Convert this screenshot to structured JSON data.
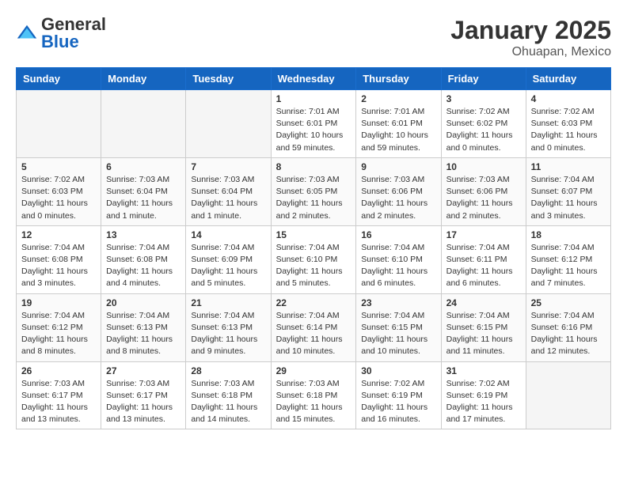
{
  "header": {
    "logo_general": "General",
    "logo_blue": "Blue",
    "month_year": "January 2025",
    "location": "Ohuapan, Mexico"
  },
  "days_of_week": [
    "Sunday",
    "Monday",
    "Tuesday",
    "Wednesday",
    "Thursday",
    "Friday",
    "Saturday"
  ],
  "weeks": [
    [
      {
        "day": "",
        "info": ""
      },
      {
        "day": "",
        "info": ""
      },
      {
        "day": "",
        "info": ""
      },
      {
        "day": "1",
        "info": "Sunrise: 7:01 AM\nSunset: 6:01 PM\nDaylight: 10 hours\nand 59 minutes."
      },
      {
        "day": "2",
        "info": "Sunrise: 7:01 AM\nSunset: 6:01 PM\nDaylight: 10 hours\nand 59 minutes."
      },
      {
        "day": "3",
        "info": "Sunrise: 7:02 AM\nSunset: 6:02 PM\nDaylight: 11 hours\nand 0 minutes."
      },
      {
        "day": "4",
        "info": "Sunrise: 7:02 AM\nSunset: 6:03 PM\nDaylight: 11 hours\nand 0 minutes."
      }
    ],
    [
      {
        "day": "5",
        "info": "Sunrise: 7:02 AM\nSunset: 6:03 PM\nDaylight: 11 hours\nand 0 minutes."
      },
      {
        "day": "6",
        "info": "Sunrise: 7:03 AM\nSunset: 6:04 PM\nDaylight: 11 hours\nand 1 minute."
      },
      {
        "day": "7",
        "info": "Sunrise: 7:03 AM\nSunset: 6:04 PM\nDaylight: 11 hours\nand 1 minute."
      },
      {
        "day": "8",
        "info": "Sunrise: 7:03 AM\nSunset: 6:05 PM\nDaylight: 11 hours\nand 2 minutes."
      },
      {
        "day": "9",
        "info": "Sunrise: 7:03 AM\nSunset: 6:06 PM\nDaylight: 11 hours\nand 2 minutes."
      },
      {
        "day": "10",
        "info": "Sunrise: 7:03 AM\nSunset: 6:06 PM\nDaylight: 11 hours\nand 2 minutes."
      },
      {
        "day": "11",
        "info": "Sunrise: 7:04 AM\nSunset: 6:07 PM\nDaylight: 11 hours\nand 3 minutes."
      }
    ],
    [
      {
        "day": "12",
        "info": "Sunrise: 7:04 AM\nSunset: 6:08 PM\nDaylight: 11 hours\nand 3 minutes."
      },
      {
        "day": "13",
        "info": "Sunrise: 7:04 AM\nSunset: 6:08 PM\nDaylight: 11 hours\nand 4 minutes."
      },
      {
        "day": "14",
        "info": "Sunrise: 7:04 AM\nSunset: 6:09 PM\nDaylight: 11 hours\nand 5 minutes."
      },
      {
        "day": "15",
        "info": "Sunrise: 7:04 AM\nSunset: 6:10 PM\nDaylight: 11 hours\nand 5 minutes."
      },
      {
        "day": "16",
        "info": "Sunrise: 7:04 AM\nSunset: 6:10 PM\nDaylight: 11 hours\nand 6 minutes."
      },
      {
        "day": "17",
        "info": "Sunrise: 7:04 AM\nSunset: 6:11 PM\nDaylight: 11 hours\nand 6 minutes."
      },
      {
        "day": "18",
        "info": "Sunrise: 7:04 AM\nSunset: 6:12 PM\nDaylight: 11 hours\nand 7 minutes."
      }
    ],
    [
      {
        "day": "19",
        "info": "Sunrise: 7:04 AM\nSunset: 6:12 PM\nDaylight: 11 hours\nand 8 minutes."
      },
      {
        "day": "20",
        "info": "Sunrise: 7:04 AM\nSunset: 6:13 PM\nDaylight: 11 hours\nand 8 minutes."
      },
      {
        "day": "21",
        "info": "Sunrise: 7:04 AM\nSunset: 6:13 PM\nDaylight: 11 hours\nand 9 minutes."
      },
      {
        "day": "22",
        "info": "Sunrise: 7:04 AM\nSunset: 6:14 PM\nDaylight: 11 hours\nand 10 minutes."
      },
      {
        "day": "23",
        "info": "Sunrise: 7:04 AM\nSunset: 6:15 PM\nDaylight: 11 hours\nand 10 minutes."
      },
      {
        "day": "24",
        "info": "Sunrise: 7:04 AM\nSunset: 6:15 PM\nDaylight: 11 hours\nand 11 minutes."
      },
      {
        "day": "25",
        "info": "Sunrise: 7:04 AM\nSunset: 6:16 PM\nDaylight: 11 hours\nand 12 minutes."
      }
    ],
    [
      {
        "day": "26",
        "info": "Sunrise: 7:03 AM\nSunset: 6:17 PM\nDaylight: 11 hours\nand 13 minutes."
      },
      {
        "day": "27",
        "info": "Sunrise: 7:03 AM\nSunset: 6:17 PM\nDaylight: 11 hours\nand 13 minutes."
      },
      {
        "day": "28",
        "info": "Sunrise: 7:03 AM\nSunset: 6:18 PM\nDaylight: 11 hours\nand 14 minutes."
      },
      {
        "day": "29",
        "info": "Sunrise: 7:03 AM\nSunset: 6:18 PM\nDaylight: 11 hours\nand 15 minutes."
      },
      {
        "day": "30",
        "info": "Sunrise: 7:02 AM\nSunset: 6:19 PM\nDaylight: 11 hours\nand 16 minutes."
      },
      {
        "day": "31",
        "info": "Sunrise: 7:02 AM\nSunset: 6:19 PM\nDaylight: 11 hours\nand 17 minutes."
      },
      {
        "day": "",
        "info": ""
      }
    ]
  ]
}
